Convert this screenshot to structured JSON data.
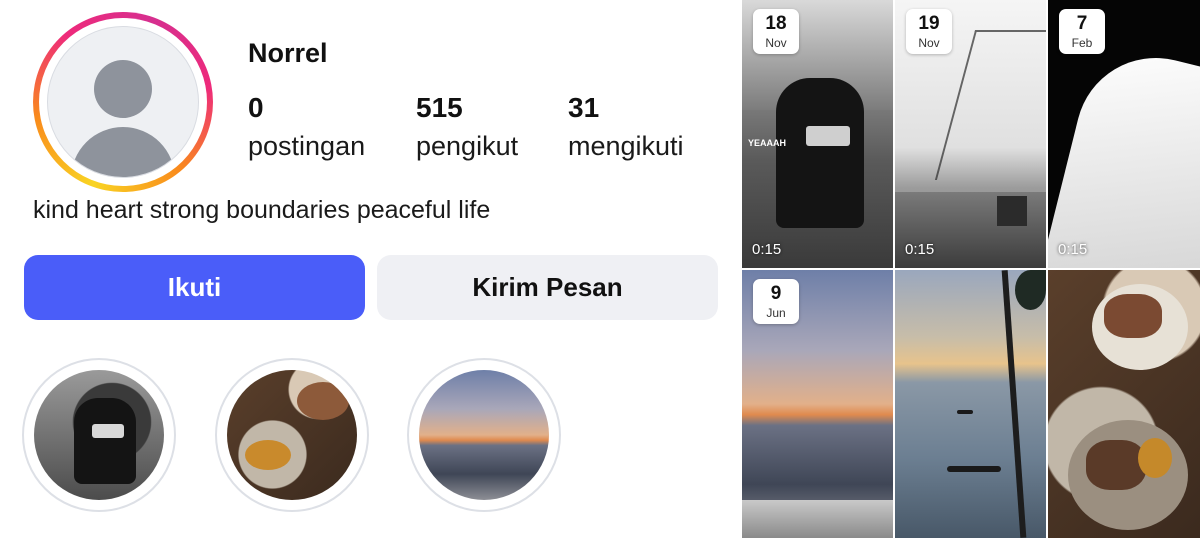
{
  "profile": {
    "username": "Norrel",
    "stats": [
      {
        "value": "0",
        "label": "postingan"
      },
      {
        "value": "515",
        "label": "pengikut"
      },
      {
        "value": "31",
        "label": "mengikuti"
      }
    ],
    "bio": "kind heart strong boundaries peaceful life",
    "follow_label": "Ikuti",
    "message_label": "Kirim Pesan"
  },
  "highlights": [
    {
      "icon": "highlight-person-photo"
    },
    {
      "icon": "highlight-food-photo"
    },
    {
      "icon": "highlight-sunset-photo"
    }
  ],
  "grid": [
    {
      "day": "18",
      "month": "Nov",
      "duration": "0:15",
      "overlay_text": "YEAAAH"
    },
    {
      "day": "19",
      "month": "Nov",
      "duration": "0:15"
    },
    {
      "day": "7",
      "month": "Feb",
      "duration": "0:15"
    },
    {
      "day": "9",
      "month": "Jun"
    },
    {},
    {}
  ],
  "colors": {
    "follow_button": "#4a5df9",
    "message_button": "#eff0f4",
    "story_ring": [
      "#f9d423",
      "#ee2a7b"
    ]
  }
}
